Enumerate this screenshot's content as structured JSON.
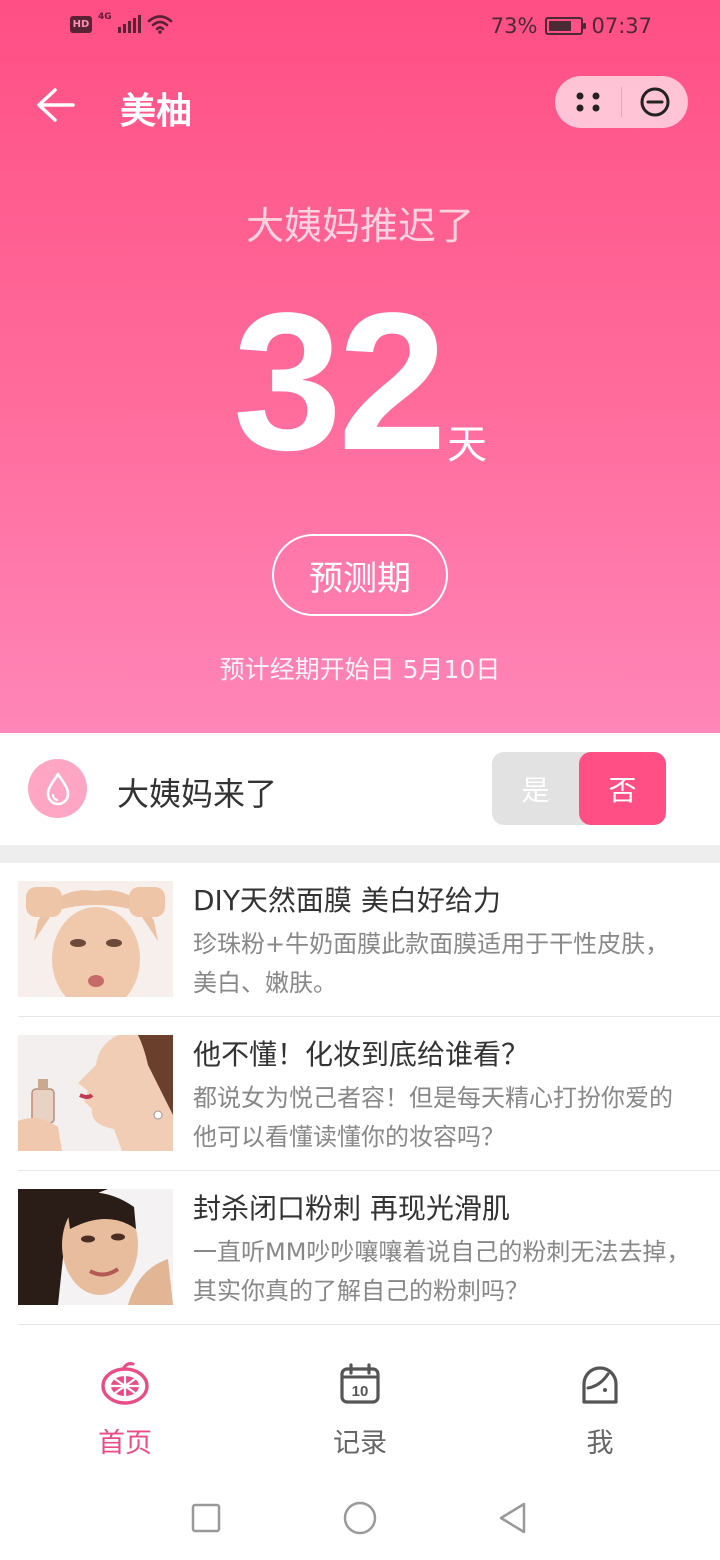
{
  "status_bar": {
    "hd_badge": "HD",
    "network": "4G",
    "battery_percent": "73%",
    "battery_level": 0.73,
    "time": "07:37"
  },
  "nav": {
    "title": "美柚",
    "back_icon": "arrow-left-icon",
    "more_icon": "dots-icon",
    "close_icon": "minus-circle-icon"
  },
  "hero": {
    "status_text": "大姨妈推迟了",
    "days_number": "32",
    "days_unit": "天",
    "phase_button": "预测期",
    "expected_start": "预计经期开始日 5月10日"
  },
  "period_toggle": {
    "label": "大姨妈来了",
    "yes": "是",
    "no": "否",
    "selected": "否",
    "icon": "drop-icon"
  },
  "articles": [
    {
      "title": "DIY天然面膜 美白好给力",
      "desc": "珍珠粉+牛奶面膜此款面膜适用于干性皮肤，美白、嫩肤。"
    },
    {
      "title": "他不懂！化妆到底给谁看？",
      "desc": "都说女为悦己者容！但是每天精心打扮你爱的他可以看懂读懂你的妆容吗？"
    },
    {
      "title": "封杀闭口粉刺 再现光滑肌",
      "desc": "一直听MM吵吵嚷嚷着说自己的粉刺无法去掉，其实你真的了解自己的粉刺吗？"
    }
  ],
  "tabs": [
    {
      "label": "首页",
      "icon": "grapefruit-icon",
      "active": true
    },
    {
      "label": "记录",
      "icon": "calendar-icon",
      "calendar_day": "10",
      "active": false
    },
    {
      "label": "我",
      "icon": "profile-face-icon",
      "active": false
    }
  ],
  "colors": {
    "accent": "#ff4f85",
    "gradient_top": "#ff4f85",
    "gradient_bottom": "#ff86b8",
    "tab_active": "#e94d88"
  }
}
